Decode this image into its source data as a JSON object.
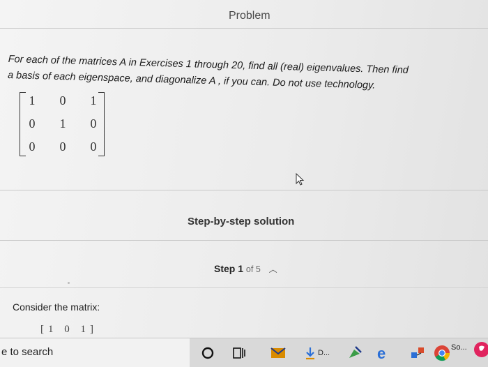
{
  "header": {
    "title": "Problem"
  },
  "question": {
    "line1": "For each of the matrices A in Exercises 1 through 20, find all (real) eigenvalues. Then find",
    "line2": "a basis of each eigenspace, and diagonalize A , if you can. Do not use technology."
  },
  "matrix": {
    "rows": [
      [
        "1",
        "0",
        "1"
      ],
      [
        "0",
        "1",
        "0"
      ],
      [
        "0",
        "0",
        "0"
      ]
    ]
  },
  "solution": {
    "link_label": "Step-by-step solution",
    "step_label": "Step",
    "step_current": "1",
    "step_of": "of 5"
  },
  "content": {
    "consider_text": "Consider the matrix:",
    "partial_row": "[1 0 1]"
  },
  "taskbar": {
    "search_text": "e to search",
    "download_label": "D...",
    "chrome_label": "So..."
  }
}
